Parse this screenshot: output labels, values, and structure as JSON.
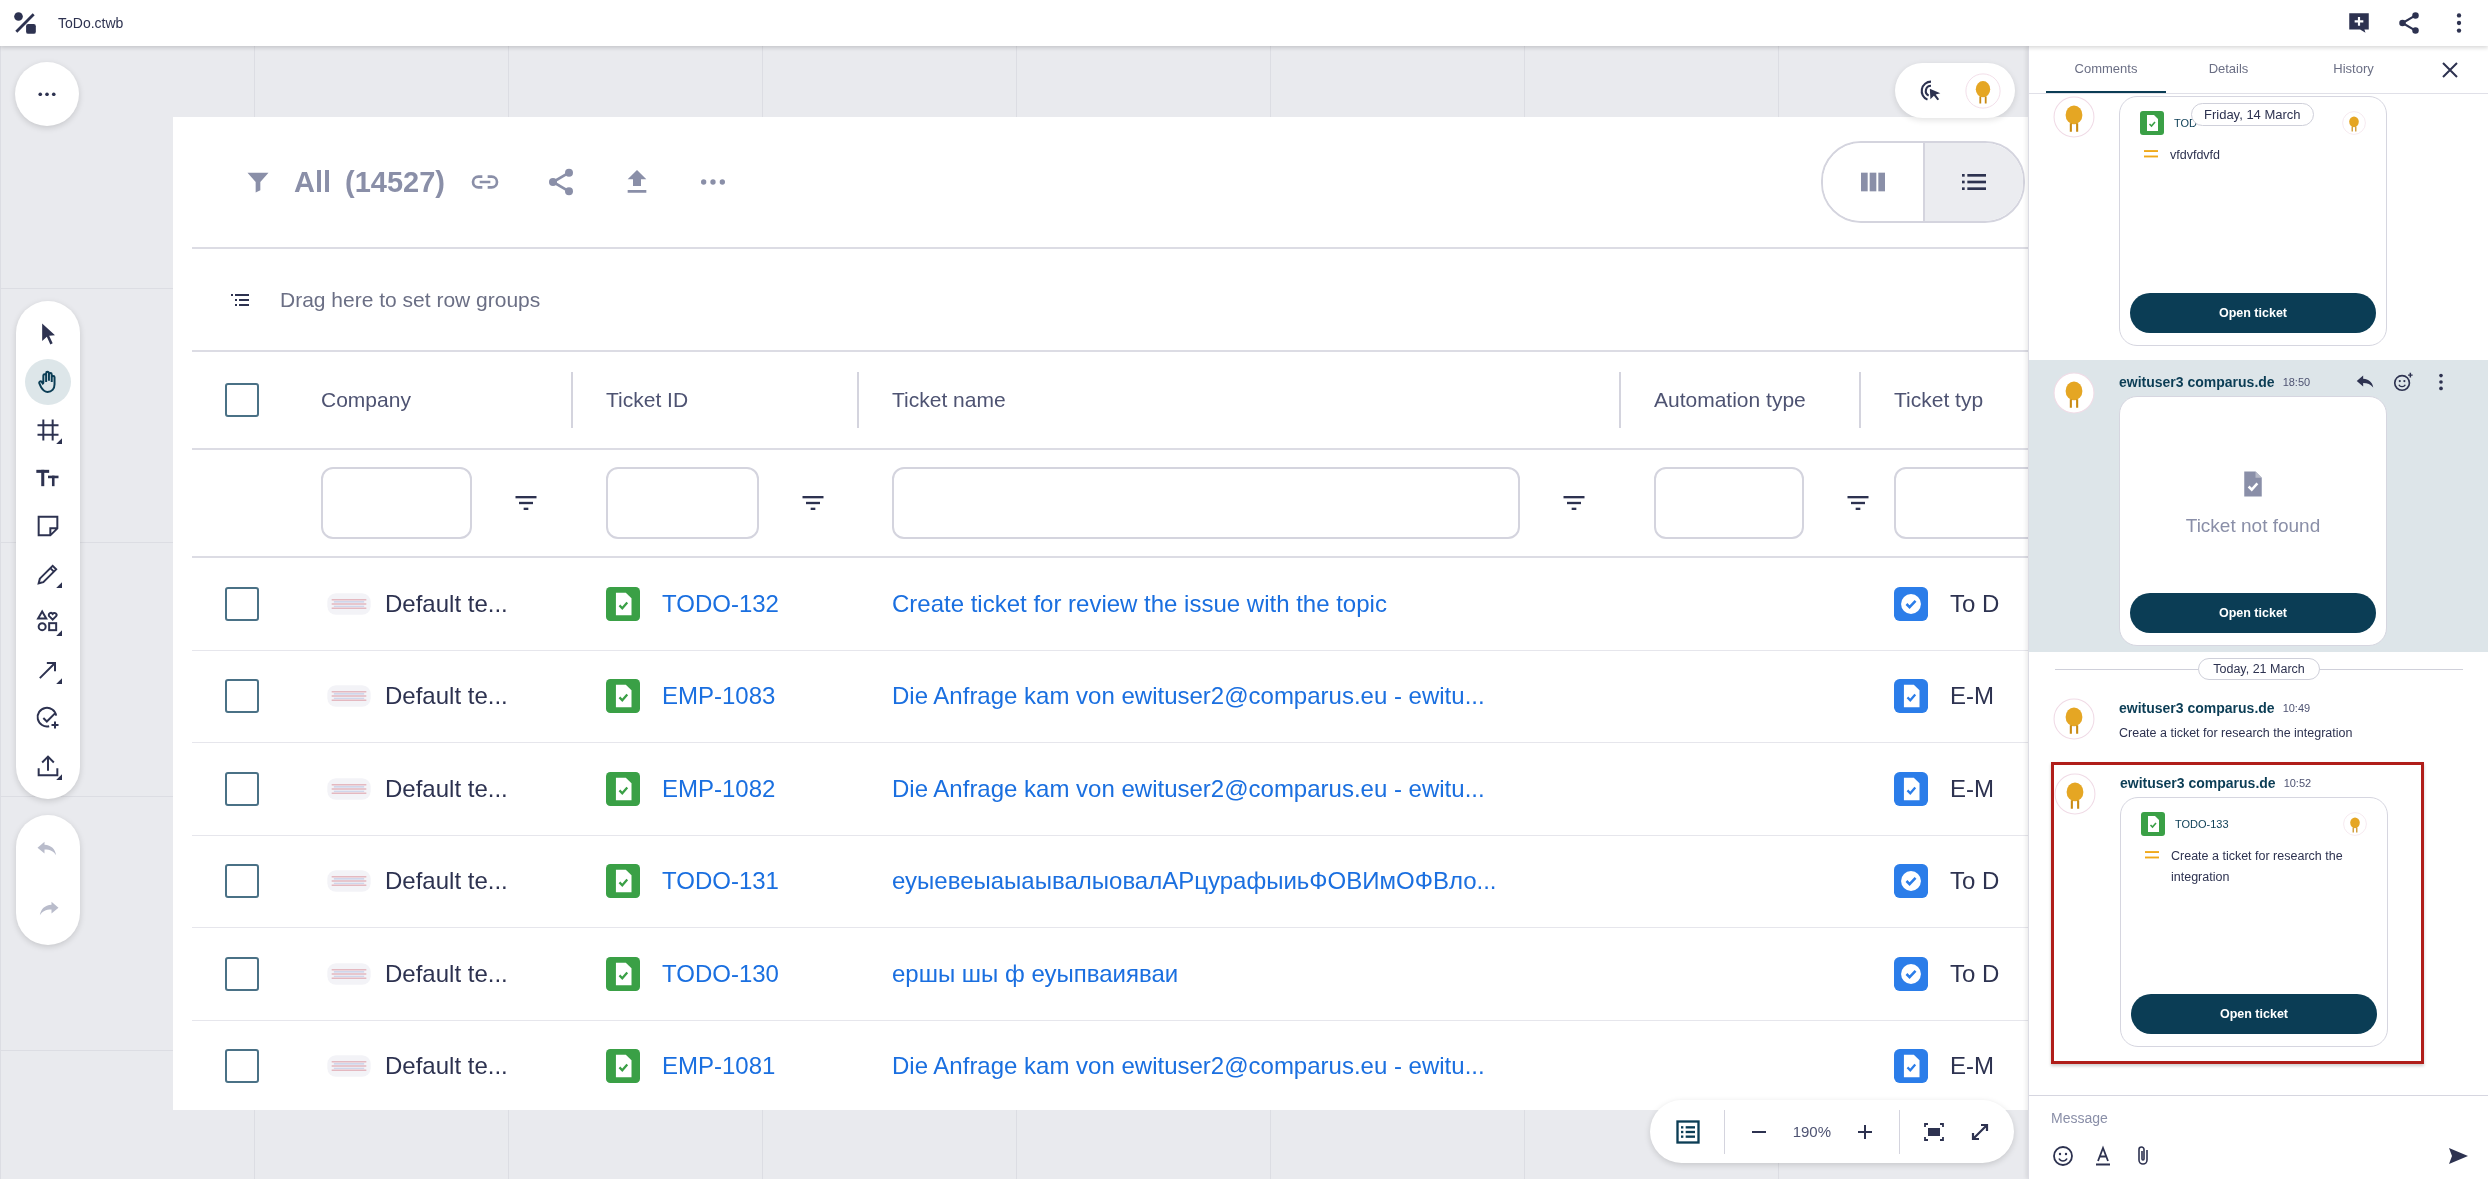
{
  "app_bar": {
    "file_name": "ToDo.ctwb"
  },
  "tools": [
    {
      "kind": "select",
      "selected": false,
      "submenu": false
    },
    {
      "kind": "hand",
      "selected": true,
      "submenu": false
    },
    {
      "kind": "frame",
      "selected": false,
      "submenu": true
    },
    {
      "kind": "text",
      "selected": false,
      "submenu": false
    },
    {
      "kind": "note",
      "selected": false,
      "submenu": false
    },
    {
      "kind": "pen",
      "selected": false,
      "submenu": true
    },
    {
      "kind": "shapes",
      "selected": false,
      "submenu": true
    },
    {
      "kind": "arrow",
      "selected": false,
      "submenu": true
    },
    {
      "kind": "task",
      "selected": false,
      "submenu": false
    },
    {
      "kind": "upload",
      "selected": false,
      "submenu": true
    }
  ],
  "history": [
    {
      "kind": "undo",
      "disabled": true
    },
    {
      "kind": "redo",
      "disabled": true
    }
  ],
  "table": {
    "view": "All",
    "count": "(14527)",
    "view_modes": [
      {
        "kind": "board",
        "selected": false
      },
      {
        "kind": "list",
        "selected": true
      }
    ],
    "group_hint": "Drag here to set row groups",
    "all_checked": false,
    "columns": [
      {
        "label": "Company"
      },
      {
        "label": "Ticket ID"
      },
      {
        "label": "Ticket name"
      },
      {
        "label": "Automation type"
      },
      {
        "label": "Ticket typ"
      }
    ],
    "rows": [
      {
        "checked": false,
        "company": "Default te...",
        "ticket_id": "TODO-132",
        "ticket_name": "Create ticket for review the issue with the topic",
        "ticket_type": "To D",
        "kind": "todo"
      },
      {
        "checked": false,
        "company": "Default te...",
        "ticket_id": "EMP-1083",
        "ticket_name": "Die Anfrage kam von ewituser2@comparus.eu - ewitu...",
        "ticket_type": "E-M",
        "kind": "email"
      },
      {
        "checked": false,
        "company": "Default te...",
        "ticket_id": "EMP-1082",
        "ticket_name": "Die Anfrage kam von ewituser2@comparus.eu - ewitu...",
        "ticket_type": "E-M",
        "kind": "email"
      },
      {
        "checked": false,
        "company": "Default te...",
        "ticket_id": "TODO-131",
        "ticket_name": "еуыевеыаыаывалыовалАРцурафыиьФОВИмОФВло...",
        "ticket_type": "To D",
        "kind": "todo"
      },
      {
        "checked": false,
        "company": "Default te...",
        "ticket_id": "TODO-130",
        "ticket_name": "ершы шы ф еуыпваияваи",
        "ticket_type": "To D",
        "kind": "todo"
      },
      {
        "checked": false,
        "company": "Default te...",
        "ticket_id": "EMP-1081",
        "ticket_name": "Die Anfrage kam von ewituser2@comparus.eu - ewitu...",
        "ticket_type": "E-M",
        "kind": "email"
      }
    ]
  },
  "zoom": {
    "value": "190%"
  },
  "panel": {
    "tabs": [
      {
        "label": "Comments",
        "selected": true
      },
      {
        "label": "Details",
        "selected": false
      },
      {
        "label": "History",
        "selected": false
      }
    ],
    "sticky_date": "Friday, 14 March",
    "feed": [
      {
        "kind": "ticket",
        "ticket_id": "TOD",
        "summary": "vfdvfdvfd",
        "button": "Open ticket",
        "highlighted": false,
        "framed": false
      },
      {
        "kind": "not_found",
        "author": "ewituser3 comparus.de",
        "time": "18:50",
        "text": "Ticket not found",
        "button": "Open ticket",
        "highlighted": true,
        "framed": false
      },
      {
        "kind": "date",
        "text": "Today, 21 March"
      },
      {
        "kind": "text",
        "author": "ewituser3 comparus.de",
        "time": "10:49",
        "text": "Create a ticket for research the integration",
        "highlighted": false,
        "framed": false
      },
      {
        "kind": "ticket",
        "author": "ewituser3 comparus.de",
        "time": "10:52",
        "ticket_id": "TODO-133",
        "summary": "Create a ticket for research the integration",
        "button": "Open ticket",
        "highlighted": false,
        "framed": true
      }
    ],
    "composer": {
      "placeholder": "Message"
    }
  }
}
